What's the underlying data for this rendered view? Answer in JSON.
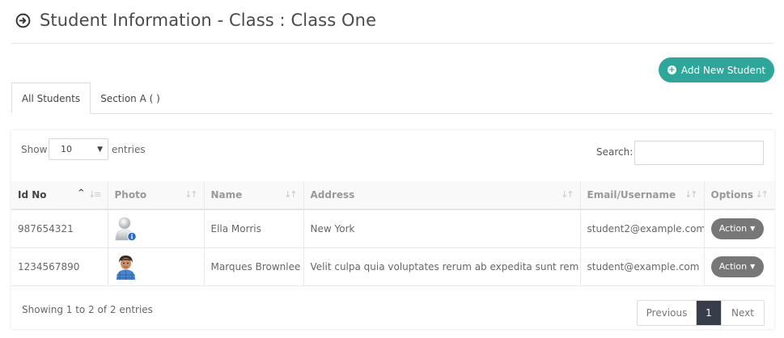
{
  "header": {
    "title": "Student Information - Class : Class One",
    "icon": "arrow-circle-right-icon"
  },
  "add_button": {
    "label": "Add New Student",
    "icon": "plus-circle-icon",
    "color": "#2fa69a"
  },
  "tabs": [
    {
      "label": "All Students",
      "active": true
    },
    {
      "label": "Section A ( )",
      "active": false
    }
  ],
  "controls": {
    "show_label": "Show",
    "entries_value": "10",
    "entries_label": "entries",
    "search_label": "Search:",
    "search_value": ""
  },
  "table": {
    "columns": [
      "Id No",
      "Photo",
      "Name",
      "Address",
      "Email/Username",
      "Options"
    ],
    "sorted_column": "Id No",
    "rows": [
      {
        "id": "987654321",
        "photo": "default-user-avatar",
        "name": "Ella Morris",
        "address": "New York",
        "email": "student2@example.com",
        "action": "Action"
      },
      {
        "id": "1234567890",
        "photo": "student-photo",
        "name": "Marques Brownlee",
        "address": "Velit culpa quia voluptates rerum ab expedita sunt rem ad",
        "email": "student@example.com",
        "action": "Action"
      }
    ]
  },
  "footer": {
    "info": "Showing 1 to 2 of 2 entries",
    "pagination": {
      "previous": "Previous",
      "current": "1",
      "next": "Next"
    }
  },
  "colors": {
    "accent": "#2fa69a",
    "action": "#777777",
    "current_page": "#383d4a"
  }
}
